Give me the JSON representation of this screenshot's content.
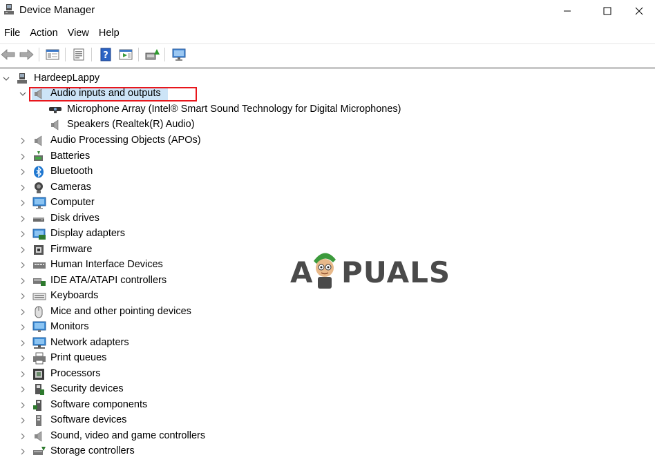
{
  "window": {
    "title": "Device Manager"
  },
  "menu": [
    "File",
    "Action",
    "View",
    "Help"
  ],
  "toolbar": {
    "buttons": [
      "back-icon",
      "forward-icon",
      "show-hide-console-tree-icon",
      "properties-icon",
      "help-icon",
      "action-pane-icon",
      "update-driver-icon",
      "scan-hardware-icon"
    ]
  },
  "tree": {
    "root": "HardeepLappy",
    "expanded_category": "Audio inputs and outputs",
    "children": [
      "Microphone Array (Intel® Smart Sound Technology for Digital Microphones)",
      "Speakers (Realtek(R) Audio)"
    ],
    "categories": [
      "Audio Processing Objects (APOs)",
      "Batteries",
      "Bluetooth",
      "Cameras",
      "Computer",
      "Disk drives",
      "Display adapters",
      "Firmware",
      "Human Interface Devices",
      "IDE ATA/ATAPI controllers",
      "Keyboards",
      "Mice and other pointing devices",
      "Monitors",
      "Network adapters",
      "Print queues",
      "Processors",
      "Security devices",
      "Software components",
      "Software devices",
      "Sound, video and game controllers",
      "Storage controllers"
    ]
  },
  "watermark": {
    "text_left": "A",
    "text_right": "PUALS"
  },
  "colors": {
    "selection": "#cce4f7",
    "highlight_box": "#e8161c"
  }
}
